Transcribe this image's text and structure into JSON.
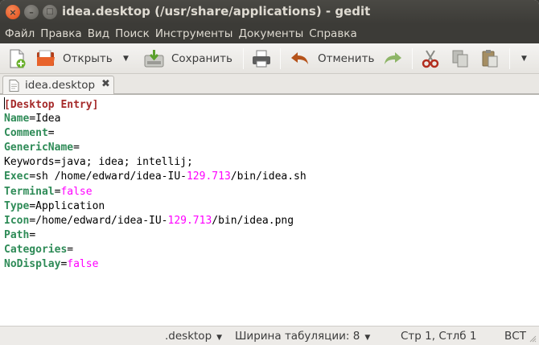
{
  "window": {
    "title": "idea.desktop (/usr/share/applications) - gedit",
    "close_glyph": "×",
    "minimize_glyph": "–",
    "maximize_glyph": "□"
  },
  "menubar": {
    "items": [
      "Файл",
      "Правка",
      "Вид",
      "Поиск",
      "Инструменты",
      "Документы",
      "Справка"
    ]
  },
  "toolbar": {
    "open_label": "Открыть",
    "save_label": "Сохранить",
    "undo_label": "Отменить",
    "dropdown_glyph": "▼"
  },
  "tabs": [
    {
      "label": "idea.desktop",
      "close_glyph": "✖"
    }
  ],
  "editor": {
    "lines": [
      [
        {
          "t": "[Desktop Entry]",
          "c": "header"
        }
      ],
      [
        {
          "t": "Name",
          "c": "key"
        },
        {
          "t": "=Idea",
          "c": "text"
        }
      ],
      [
        {
          "t": "Comment",
          "c": "key"
        },
        {
          "t": "=",
          "c": "text"
        }
      ],
      [
        {
          "t": "GenericName",
          "c": "key"
        },
        {
          "t": "=",
          "c": "text"
        }
      ],
      [
        {
          "t": "Keywords=java; idea; intellij;",
          "c": "text"
        }
      ],
      [
        {
          "t": "Exec",
          "c": "key"
        },
        {
          "t": "=sh /home/edward/idea-IU-",
          "c": "text"
        },
        {
          "t": "129.713",
          "c": "num"
        },
        {
          "t": "/bin/idea.sh",
          "c": "text"
        }
      ],
      [
        {
          "t": "Terminal",
          "c": "key"
        },
        {
          "t": "=",
          "c": "text"
        },
        {
          "t": "false",
          "c": "bool"
        }
      ],
      [
        {
          "t": "Type",
          "c": "key"
        },
        {
          "t": "=Application",
          "c": "text"
        }
      ],
      [
        {
          "t": "Icon",
          "c": "key"
        },
        {
          "t": "=/home/edward/idea-IU-",
          "c": "text"
        },
        {
          "t": "129.713",
          "c": "num"
        },
        {
          "t": "/bin/idea.png",
          "c": "text"
        }
      ],
      [
        {
          "t": "Path",
          "c": "key"
        },
        {
          "t": "=",
          "c": "text"
        }
      ],
      [
        {
          "t": "Categories",
          "c": "key"
        },
        {
          "t": "=",
          "c": "text"
        }
      ],
      [
        {
          "t": "NoDisplay",
          "c": "key"
        },
        {
          "t": "=",
          "c": "text"
        },
        {
          "t": "false",
          "c": "bool"
        }
      ]
    ]
  },
  "statusbar": {
    "language": ".desktop",
    "tab_width_label": "Ширина табуляции:",
    "tab_width_value": "8",
    "position": "Стр 1, Стлб 1",
    "insert_mode": "ВСТ",
    "dropdown_glyph": "▼"
  },
  "colors": {
    "header": "#a52a2a",
    "key": "#2e8b57",
    "value_special": "#ff00ff",
    "titlebar": "#3c3b37",
    "close_button": "#df4a16"
  }
}
